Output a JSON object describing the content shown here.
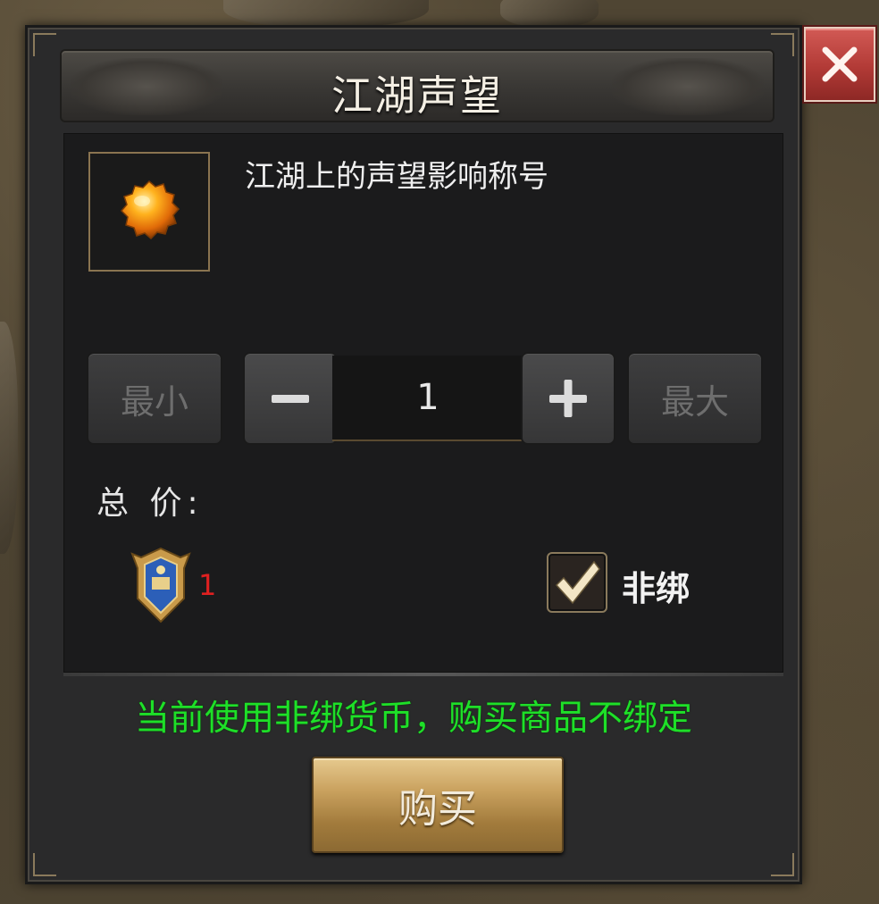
{
  "dialog": {
    "title": "江湖声望",
    "close_icon": "close-icon"
  },
  "item": {
    "icon": "orange-gem-icon",
    "description": "江湖上的声望影响称号"
  },
  "quantity": {
    "min_label": "最小",
    "max_label": "最大",
    "minus_icon": "minus-icon",
    "plus_icon": "plus-icon",
    "value": "1"
  },
  "price": {
    "label": "总 价:",
    "currency_icon": "shield-emblem-icon",
    "value": "1"
  },
  "binding": {
    "checked": true,
    "label": "非绑"
  },
  "notice": "当前使用非绑货币，购买商品不绑定",
  "buy_label": "购买",
  "colors": {
    "notice": "#1ee028",
    "price": "#e02020",
    "close": "#c04440",
    "buy": "#c9a15e"
  }
}
